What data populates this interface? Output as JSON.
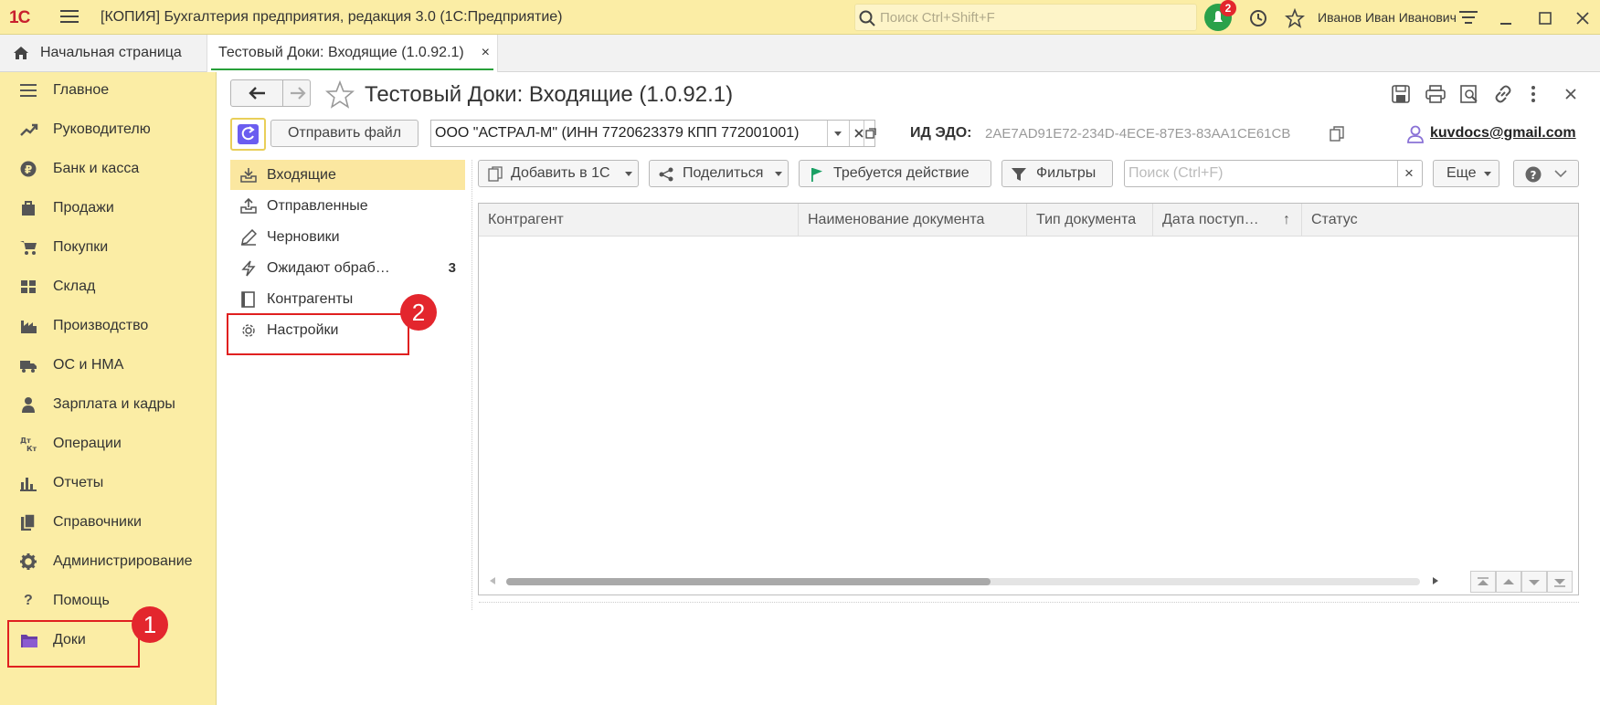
{
  "app": {
    "logo": "1С",
    "title": "[КОПИЯ] Бухгалтерия предприятия, редакция 3.0  (1С:Предприятие)",
    "search_placeholder": "Поиск Ctrl+Shift+F",
    "notification_count": "2",
    "user_name": "Иванов Иван Иванович"
  },
  "tabs": {
    "home": "Начальная страница",
    "active": "Тестовый Доки: Входящие (1.0.92.1)",
    "close": "×"
  },
  "sidebar": {
    "items": [
      {
        "label": "Главное",
        "icon": "menu-icon"
      },
      {
        "label": "Руководителю",
        "icon": "trend-icon"
      },
      {
        "label": "Банк и касса",
        "icon": "ruble-icon"
      },
      {
        "label": "Продажи",
        "icon": "bag-icon"
      },
      {
        "label": "Покупки",
        "icon": "cart-icon"
      },
      {
        "label": "Склад",
        "icon": "warehouse-icon"
      },
      {
        "label": "Производство",
        "icon": "factory-icon"
      },
      {
        "label": "ОС и НМА",
        "icon": "truck-icon"
      },
      {
        "label": "Зарплата и кадры",
        "icon": "person-icon"
      },
      {
        "label": "Операции",
        "icon": "dt-kt-icon"
      },
      {
        "label": "Отчеты",
        "icon": "bar-chart-icon"
      },
      {
        "label": "Справочники",
        "icon": "books-icon"
      },
      {
        "label": "Администрирование",
        "icon": "gear-icon"
      },
      {
        "label": "Помощь",
        "icon": "question-icon"
      },
      {
        "label": "Доки",
        "icon": "folder-icon"
      }
    ],
    "dt_kt_glyph": "Дт\nКт",
    "help_glyph": "?"
  },
  "annotations": {
    "one": "1",
    "two": "2"
  },
  "form": {
    "back": "←",
    "forward": "→",
    "title": "Тестовый Доки: Входящие (1.0.92.1)",
    "send_file": "Отправить файл",
    "org": "ООО \"АСТРАЛ-М\" (ИНН 7720623379 КПП 772001001)",
    "edo_label": "ИД ЭДО:",
    "edo_value": "2AE7AD91E72-234D-4ECE-87E3-83AA1CE61CB",
    "email": "kuvdocs@gmail.com"
  },
  "nav": {
    "items": [
      {
        "label": "Входящие",
        "icon": "inbox-icon"
      },
      {
        "label": "Отправленные",
        "icon": "outbox-icon"
      },
      {
        "label": "Черновики",
        "icon": "pencil-icon"
      },
      {
        "label": "Ожидают обраб…",
        "icon": "lightning-icon",
        "count": "3"
      },
      {
        "label": "Контрагенты",
        "icon": "book-icon"
      },
      {
        "label": "Настройки",
        "icon": "gear-icon"
      }
    ]
  },
  "toolbar": {
    "add": "Добавить в 1С",
    "share": "Поделиться",
    "action": "Требуется действие",
    "filters": "Фильтры",
    "search_placeholder": "Поиск (Ctrl+F)",
    "more": "Еще",
    "clear": "×"
  },
  "table": {
    "columns": [
      "Контрагент",
      "Наименование документа",
      "Тип документа",
      "Дата поступ…",
      "Статус"
    ],
    "sort_arrow": "↑"
  },
  "colors": {
    "sidebar": "#fbeda5",
    "accent": "#27a03a",
    "selection": "#fbe7a0",
    "highlight": "#e02020"
  }
}
